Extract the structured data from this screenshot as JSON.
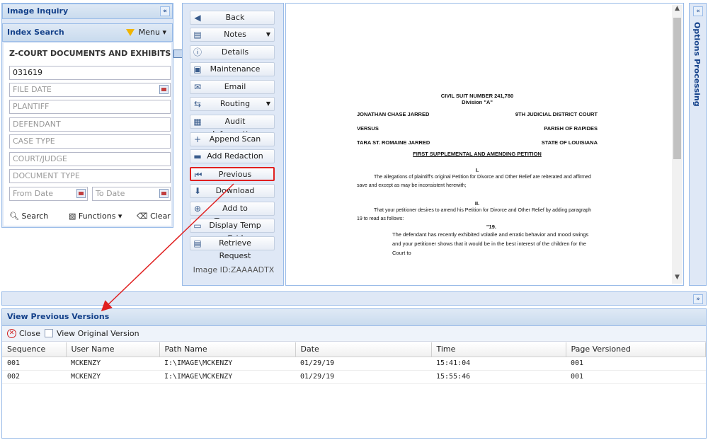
{
  "left_panel": {
    "title": "Image Inquiry",
    "collapse_glyph": "«",
    "index_search_label": "Index Search",
    "menu_label": "Menu",
    "section_title": "Z-COURT DOCUMENTS AND EXHIBITS",
    "section_chart_label": "Ch",
    "fields": {
      "index_value": "031619",
      "file_date_placeholder": "FILE DATE",
      "plaintiff_placeholder": "PLANTIFF",
      "defendant_placeholder": "DEFENDANT",
      "case_type_placeholder": "CASE TYPE",
      "court_judge_placeholder": "COURT/JUDGE",
      "document_type_placeholder": "DOCUMENT TYPE",
      "from_date_placeholder": "From Date",
      "to_date_placeholder": "To Date"
    },
    "search_label": "Search",
    "functions_label": "Functions",
    "clear_label": "Clear"
  },
  "toolbar": {
    "buttons": [
      {
        "label": "Back",
        "icon": "back-arrow-icon",
        "glyph": "◀"
      },
      {
        "label": "Notes",
        "icon": "notes-icon",
        "glyph": "▤"
      },
      {
        "label": "Details",
        "icon": "info-icon",
        "glyph": "ⓘ"
      },
      {
        "label": "Maintenance",
        "icon": "maintenance-icon",
        "glyph": "▣"
      },
      {
        "label": "Email",
        "icon": "email-icon",
        "glyph": "✉"
      },
      {
        "label": "Routing",
        "icon": "routing-icon",
        "glyph": "⇆"
      },
      {
        "label": "Audit Information",
        "icon": "audit-icon",
        "glyph": "▦"
      },
      {
        "label": "Append Scan",
        "icon": "append-scan-icon",
        "glyph": "+"
      },
      {
        "label": "Add Redaction",
        "icon": "redaction-icon",
        "glyph": "▬"
      },
      {
        "label": "Previous Versions",
        "icon": "previous-versions-icon",
        "glyph": "⏮"
      },
      {
        "label": "Download",
        "icon": "download-icon",
        "glyph": "⬇"
      },
      {
        "label": "Add to Temporary",
        "icon": "add-temporary-icon",
        "glyph": "⊕"
      },
      {
        "label": "Display Temp Grid",
        "icon": "temp-grid-icon",
        "glyph": "▭"
      },
      {
        "label": "Retrieve Request",
        "icon": "retrieve-icon",
        "glyph": "▤"
      }
    ],
    "dropdown_glyph": "▼",
    "image_id": "Image ID:ZAAAADTX"
  },
  "document": {
    "title": "CIVIL SUIT NUMBER 241,780",
    "division": "Division \"A\"",
    "plaintiff": "JONATHAN CHASE JARRED",
    "court": "9TH JUDICIAL DISTRICT COURT",
    "versus": "VERSUS",
    "parish": "PARISH OF RAPIDES",
    "defendant": "TARA ST. ROMAINE JARRED",
    "state": "STATE OF LOUISIANA",
    "petition_title": "FIRST SUPPLEMENTAL AND AMENDING PETITION",
    "section_1": "I.",
    "para_1": "The allegations of plaintiff's original Petition for Divorce and Other Relief are reiterated and affirmed save and except as may be inconsistent herewith;",
    "section_2": "II.",
    "para_2": "That your petitioner desires to amend his Petition for Divorce and Other Relief by adding paragraph 19 to read as follows:",
    "para_19_num": "\"19.",
    "para_19": "The defendant has recently exhibited volatile and erratic behavior and mood swings and your petitioner shows that it would be in the best interest of the children for the Court to"
  },
  "options_panel": {
    "title": "Options Processing",
    "collapse_glyph": "«"
  },
  "versions_panel": {
    "collapse_glyph": "»",
    "title": "View Previous Versions",
    "close_label": "Close",
    "view_original_label": "View Original Version",
    "columns": [
      "Sequence",
      "User Name",
      "Path Name",
      "Date",
      "Time",
      "Page Versioned"
    ],
    "rows": [
      [
        "001",
        "MCKENZY",
        "I:\\IMAGE\\MCKENZY",
        "01/29/19",
        "15:41:04",
        "001"
      ],
      [
        "002",
        "MCKENZY",
        "I:\\IMAGE\\MCKENZY",
        "01/29/19",
        "15:55:46",
        "001"
      ]
    ]
  },
  "colors": {
    "panel_header": "#15428b",
    "panel_border": "#99bbe8",
    "highlight": "#e02020"
  }
}
